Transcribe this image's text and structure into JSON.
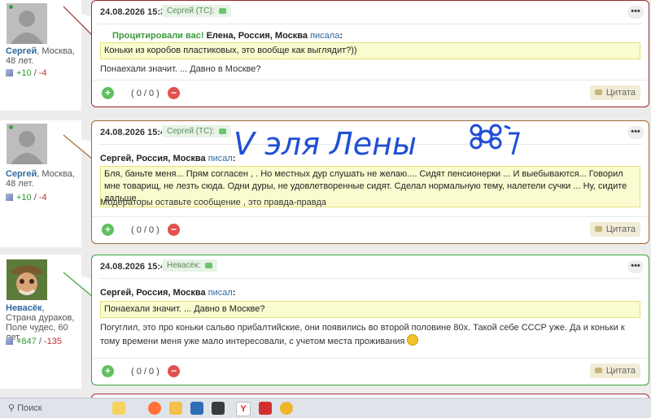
{
  "posts": [
    {
      "date": "24.08.2026 15:32",
      "tag": "Сергей (ТС):",
      "border": "#9c2b2b",
      "user": {
        "name": "Сергей",
        "loc": ", Москва, 48 лет.",
        "plus": "+10",
        "sep": " / ",
        "minus": "-4",
        "online": true
      },
      "quote_prefix": "Процитировали вас!",
      "quote_author": "Елена, Россия, Москва",
      "quote_verb": "писала",
      "quote_colon": ":",
      "quote": "Коньки из коробов пластиковых, это вообще как выглядит?))",
      "body": "Понаехали значит. ... Давно в Москве?",
      "score": "( 0 / 0 )",
      "cite": "Цитата"
    },
    {
      "date": "24.08.2026 15:43",
      "tag": "Сергей (ТС):",
      "border": "#a06a3a",
      "user": {
        "name": "Сергей",
        "loc": ", Москва, 48 лет.",
        "plus": "+10",
        "sep": " / ",
        "minus": "-4",
        "online": true
      },
      "quote_author": "Сергей, Россия, Москва",
      "quote_verb": "писал",
      "quote_colon": ":",
      "quote": "Бля, баньте меня... Прям согласен , . Но местных дур слушать не желаю.... Сидят пенсионерки ... И выебываются... Говорил мне товарищ, не лезть сюда. Одни дуры, не удовлетворенные сидят. Сделал нормальную тему, налетели сучки ... Ну, сидите дальше .",
      "body": "Модераторы оставьте сообщение , это правда-правда",
      "score": "( 0 / 0 )",
      "cite": "Цитата",
      "handwriting": "V эля Лены"
    },
    {
      "date": "24.08.2026 15:45",
      "tag": "Невасёк:",
      "border": "#3aa33a",
      "user": {
        "name": "Невасёк",
        "loc": ", Страна дураков, Поле чудес, 60 лет.",
        "plus": "+847",
        "sep": " / ",
        "minus": "-135",
        "online": false
      },
      "quote_author": "Сергей, Россия, Москва",
      "quote_verb": "писал",
      "quote_colon": ":",
      "quote": "Понаехали значит. ... Давно в Москве?",
      "body": "Погуглил, это про коньки сальво прибалтийские, они появились во второй половине 80х. Такой себе СССР уже. Да и коньки к тому времени меня уже мало интересовали, с учетом места проживания",
      "score": "( 0 / 0 )",
      "cite": "Цитата"
    }
  ],
  "taskbar": {
    "search": "Поиск"
  },
  "icons": [
    "search-icon",
    "firefox-icon",
    "folder-icon",
    "mail-icon",
    "yandex-icon",
    "app-icon",
    "chrome-icon"
  ]
}
